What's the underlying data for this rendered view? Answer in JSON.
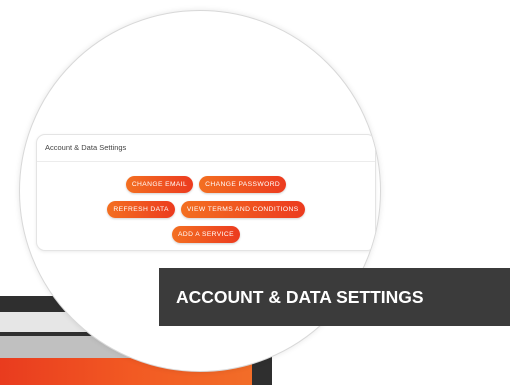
{
  "settings_panel": {
    "title": "Account & Data Settings",
    "buttons": {
      "change_email": "CHANGE EMAIL",
      "change_password": "CHANGE PASSWORD",
      "refresh_data": "REFRESH DATA",
      "view_terms": "VIEW TERMS AND CONDITIONS",
      "add_service": "ADD A SERVICE"
    }
  },
  "banner": {
    "label": "ACCOUNT & DATA SETTINGS"
  },
  "colors": {
    "accent_start": "#f36f21",
    "accent_end": "#ec3b1f",
    "banner_bg": "#3b3b3b"
  }
}
